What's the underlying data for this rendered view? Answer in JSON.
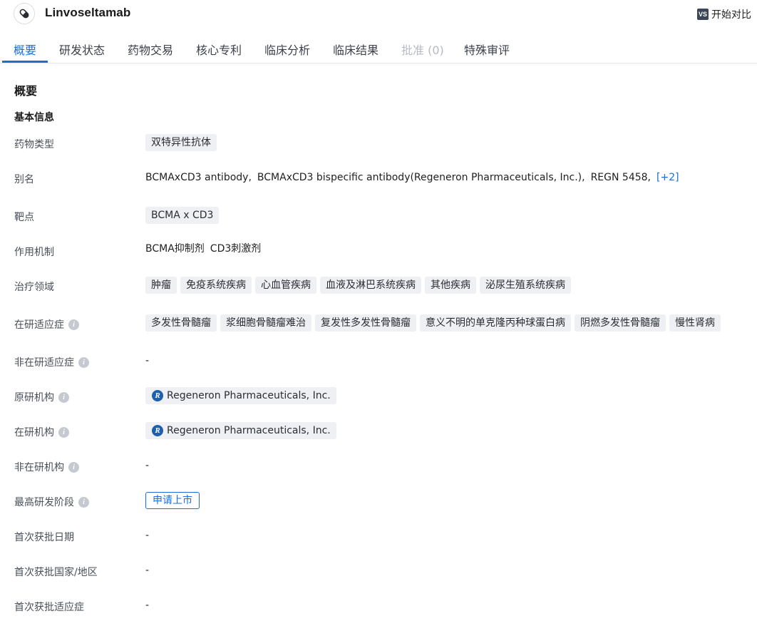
{
  "header": {
    "drug_name": "Linvoseltamab",
    "compare_label": "开始对比",
    "compare_icon_text": "VS"
  },
  "tabs": [
    {
      "label": "概要",
      "state": "active"
    },
    {
      "label": "研发状态",
      "state": "normal"
    },
    {
      "label": "药物交易",
      "state": "normal"
    },
    {
      "label": "核心专利",
      "state": "normal"
    },
    {
      "label": "临床分析",
      "state": "normal"
    },
    {
      "label": "临床结果",
      "state": "normal"
    },
    {
      "label": "批准 (0)",
      "state": "disabled"
    },
    {
      "label": "特殊审评",
      "state": "normal"
    }
  ],
  "section_title": "概要",
  "sub_title": "基本信息",
  "fields": {
    "drug_type": {
      "label": "药物类型",
      "tags": [
        "双特异性抗体"
      ]
    },
    "aliases": {
      "label": "别名",
      "values": [
        "BCMAxCD3 antibody,",
        "BCMAxCD3 bispecific antibody(Regeneron Pharmaceuticals, Inc.),",
        "REGN 5458,"
      ],
      "more": "[+2]"
    },
    "target": {
      "label": "靶点",
      "tags": [
        "BCMA x CD3"
      ]
    },
    "mechanism": {
      "label": "作用机制",
      "values": [
        "BCMA抑制剂",
        "CD3刺激剂"
      ]
    },
    "therapeutic_area": {
      "label": "治疗领域",
      "tags": [
        "肿瘤",
        "免疫系统疾病",
        "心血管疾病",
        "血液及淋巴系统疾病",
        "其他疾病",
        "泌尿生殖系统疾病"
      ]
    },
    "active_indications": {
      "label": "在研适应症",
      "tags": [
        "多发性骨髓瘤",
        "浆细胞骨髓瘤难治",
        "复发性多发性骨髓瘤",
        "意义不明的单克隆丙种球蛋白病",
        "阴燃多发性骨髓瘤",
        "慢性肾病"
      ]
    },
    "inactive_indications": {
      "label": "非在研适应症",
      "value": "-"
    },
    "originator": {
      "label": "原研机构",
      "org": "Regeneron Pharmaceuticals, Inc.",
      "logo_letter": "R"
    },
    "active_org": {
      "label": "在研机构",
      "org": "Regeneron Pharmaceuticals, Inc.",
      "logo_letter": "R"
    },
    "inactive_org": {
      "label": "非在研机构",
      "value": "-"
    },
    "highest_phase": {
      "label": "最高研发阶段",
      "value": "申请上市"
    },
    "first_approval_date": {
      "label": "首次获批日期",
      "value": "-"
    },
    "first_approval_region": {
      "label": "首次获批国家/地区",
      "value": "-"
    },
    "first_approval_indication": {
      "label": "首次获批适应症",
      "value": "-"
    }
  },
  "info_icon_glyph": "i",
  "colors": {
    "accent": "#1a6fd6",
    "tag_bg": "#eef0f3",
    "disabled": "#b6bac2"
  }
}
